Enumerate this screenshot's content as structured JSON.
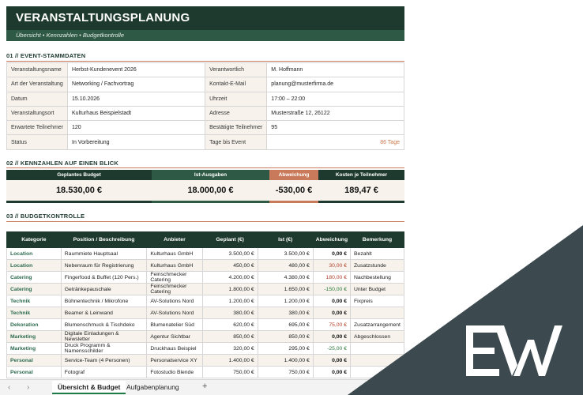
{
  "header": {
    "title": "VERANSTALTUNGSPLANUNG",
    "subtitle": "Übersicht • Kennzahlen • Budgetkontrolle"
  },
  "sections": {
    "s1": "01  //  EVENT-STAMMDATEN",
    "s2": "02  //  KENNZAHLEN AUF EINEN BLICK",
    "s3": "03  //  BUDGETKONTROLLE"
  },
  "stammdaten": [
    {
      "l1": "Veranstaltungsname",
      "v1": "Herbst-Kundenevent 2026",
      "l2": "Verantwortlich",
      "v2": "M. Hoffmann"
    },
    {
      "l1": "Art der Veranstaltung",
      "v1": "Networking / Fachvortrag",
      "l2": "Kontakt-E-Mail",
      "v2": "planung@musterfirma.de"
    },
    {
      "l1": "Datum",
      "v1": "15.10.2026",
      "l2": "Uhrzeit",
      "v2": "17:00 – 22:00"
    },
    {
      "l1": "Veranstaltungsort",
      "v1": "Kulturhaus Beispielstadt",
      "l2": "Adresse",
      "v2": "Musterstraße 12, 26122"
    },
    {
      "l1": "Erwartete Teilnehmer",
      "v1": "120",
      "l2": "Bestätigte Teilnehmer",
      "v2": "95"
    },
    {
      "l1": "Status",
      "v1": "In Vorbereitung",
      "l2": "Tage bis Event",
      "v2": "86 Tage"
    }
  ],
  "kpis": [
    {
      "label": "Geplantes Budget",
      "value": "18.530,00 €",
      "color": "#1e3a2f"
    },
    {
      "label": "Ist-Ausgaben",
      "value": "18.000,00 €",
      "color": "#2e5a45"
    },
    {
      "label": "Abweichung gesamt",
      "value": "-530,00 €",
      "color": "#c97a5a"
    },
    {
      "label": "Kosten je Teilnehmer",
      "value": "189,47 €",
      "color": "#1e3a2f"
    }
  ],
  "budget": {
    "headers": [
      "Kategorie",
      "Position / Beschreibung",
      "Anbieter",
      "Geplant (€)",
      "Ist (€)",
      "Abweichung",
      "Bemerkung"
    ],
    "rows": [
      {
        "cat": "Location",
        "pos": "Raummiete Hauptsaal",
        "anb": "Kulturhaus GmbH",
        "plan": "3.500,00 €",
        "ist": "3.500,00 €",
        "dev": "0,00 €",
        "devType": "zero",
        "bem": "Bezahlt"
      },
      {
        "cat": "Location",
        "pos": "Nebenraum für Registrierung",
        "anb": "Kulturhaus GmbH",
        "plan": "450,00 €",
        "ist": "480,00 €",
        "dev": "30,00 €",
        "devType": "pos",
        "bem": "Zusatzstunde"
      },
      {
        "cat": "Catering",
        "pos": "Fingerfood & Buffet (120 Pers.)",
        "anb": "Feinschmecker Catering",
        "plan": "4.200,00 €",
        "ist": "4.380,00 €",
        "dev": "180,00 €",
        "devType": "pos",
        "bem": "Nachbestellung"
      },
      {
        "cat": "Catering",
        "pos": "Getränkepauschale",
        "anb": "Feinschmecker Catering",
        "plan": "1.800,00 €",
        "ist": "1.650,00 €",
        "dev": "-150,00 €",
        "devType": "neg",
        "bem": "Unter Budget"
      },
      {
        "cat": "Technik",
        "pos": "Bühnentechnik / Mikrofone",
        "anb": "AV-Solutions Nord",
        "plan": "1.200,00 €",
        "ist": "1.200,00 €",
        "dev": "0,00 €",
        "devType": "zero",
        "bem": "Fixpreis"
      },
      {
        "cat": "Technik",
        "pos": "Beamer & Leinwand",
        "anb": "AV-Solutions Nord",
        "plan": "380,00 €",
        "ist": "380,00 €",
        "dev": "0,00 €",
        "devType": "zero",
        "bem": ""
      },
      {
        "cat": "Dekoration",
        "pos": "Blumenschmuck & Tischdeko",
        "anb": "Blumenatelier Süd",
        "plan": "620,00 €",
        "ist": "695,00 €",
        "dev": "75,00 €",
        "devType": "pos",
        "bem": "Zusatzarrangement"
      },
      {
        "cat": "Marketing",
        "pos": "Digitale Einladungen & Newsletter",
        "anb": "Agentur Sichtbar",
        "plan": "850,00 €",
        "ist": "850,00 €",
        "dev": "0,00 €",
        "devType": "zero",
        "bem": "Abgeschlossen"
      },
      {
        "cat": "Marketing",
        "pos": "Druck Programm & Namensschilder",
        "anb": "Druckhaus Beispiel",
        "plan": "320,00 €",
        "ist": "295,00 €",
        "dev": "-25,00 €",
        "devType": "neg",
        "bem": ""
      },
      {
        "cat": "Personal",
        "pos": "Service-Team (4 Personen)",
        "anb": "Personalservice XY",
        "plan": "1.400,00 €",
        "ist": "1.400,00 €",
        "dev": "0,00 €",
        "devType": "zero",
        "bem": ""
      },
      {
        "cat": "Personal",
        "pos": "Fotograf",
        "anb": "Fotostudio Blende",
        "plan": "750,00 €",
        "ist": "750,00 €",
        "dev": "0,00 €",
        "devType": "zero",
        "bem": ""
      }
    ]
  },
  "tabs": {
    "items": [
      "Übersicht & Budget",
      "Aufgabenplanung"
    ],
    "active": 0,
    "add": "+"
  },
  "colors": {
    "dark_green": "#1e3a2f",
    "mid_green": "#2e5a45",
    "accent_orange": "#c97a5a",
    "overlay": "#3c4a50"
  }
}
